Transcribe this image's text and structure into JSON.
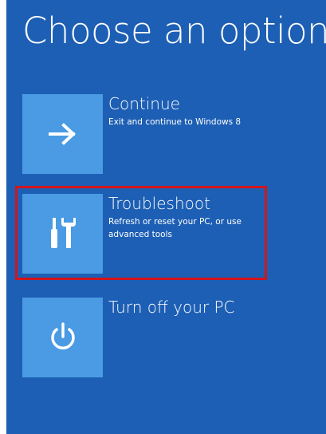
{
  "page": {
    "title": "Choose an option"
  },
  "options": [
    {
      "title": "Continue",
      "description": "Exit and continue to Windows 8",
      "icon": "arrow-right-icon"
    },
    {
      "title": "Troubleshoot",
      "description": "Refresh or reset your PC, or use advanced tools",
      "icon": "tools-icon"
    },
    {
      "title": "Turn off your PC",
      "description": "",
      "icon": "power-icon"
    }
  ],
  "colors": {
    "background": "#1d5fb4",
    "tile": "#4a9be3",
    "highlight": "#d3141c"
  }
}
